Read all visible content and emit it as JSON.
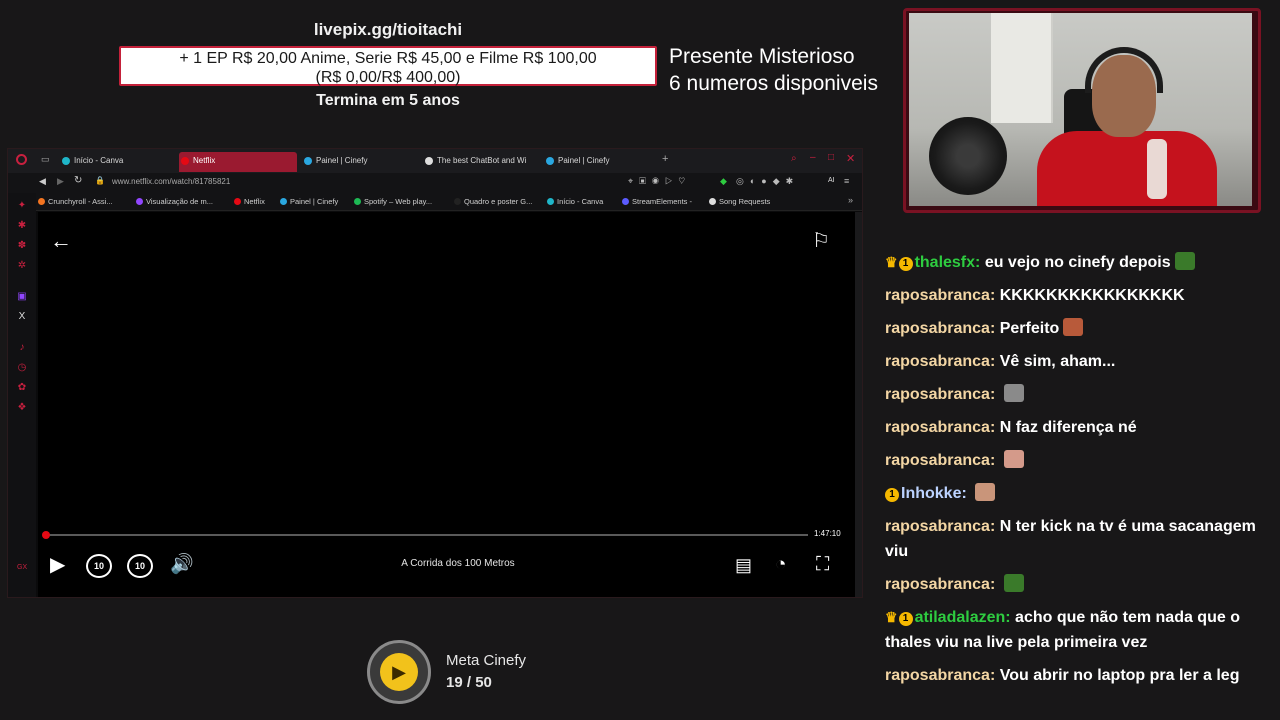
{
  "overlay": {
    "livepix": "livepix.gg/tioitachi",
    "goal_line1": "+ 1 EP R$ 20,00 Anime, Serie R$ 45,00 e Filme R$ 100,00",
    "goal_line2": "(R$ 0,00/R$ 400,00)",
    "goal_end": "Termina em 5 anos",
    "mystery_title": "Presente Misterioso",
    "mystery_sub": "6 numeros disponiveis"
  },
  "browser": {
    "tabs": [
      {
        "label": "Início - Canva",
        "active": false
      },
      {
        "label": "Netflix",
        "active": true
      },
      {
        "label": "Painel | Cinefy",
        "active": false
      },
      {
        "label": "The best ChatBot and Wi",
        "active": false
      },
      {
        "label": "Painel | Cinefy",
        "active": false
      }
    ],
    "url": "www.netflix.com/watch/81785821",
    "bookmarks": [
      "Crunchyroll - Assi...",
      "Visualização de m...",
      "Netflix",
      "Painel | Cinefy",
      "Spotify – Web play...",
      "Quadro e poster G...",
      "Início - Canva",
      "StreamElements -",
      "Song Requests"
    ],
    "ai_label": "AI"
  },
  "player": {
    "time_remaining": "1:47:10",
    "title": "A Corrida dos 100 Metros",
    "progress": 0.003,
    "skip_back": "10",
    "skip_forward": "10"
  },
  "meta": {
    "title": "Meta Cinefy",
    "current": "19",
    "separator": "/",
    "total": "50"
  },
  "chat": [
    {
      "user": "thalesfx",
      "text": "eu vejo no cinefy depois",
      "color": "green",
      "badges": [
        "crown",
        "1"
      ],
      "emote": "#3a7a2a"
    },
    {
      "user": "raposabranca",
      "text": "KKKKKKKKKKKKKKKK",
      "color": "tan",
      "badges": [],
      "emote": ""
    },
    {
      "user": "raposabranca",
      "text": "Perfeito",
      "color": "tan",
      "badges": [],
      "emote": "#b85a3a"
    },
    {
      "user": "raposabranca",
      "text": "Vê sim, aham...",
      "color": "tan",
      "badges": [],
      "emote": ""
    },
    {
      "user": "raposabranca",
      "text": "",
      "color": "tan",
      "badges": [],
      "emote": "#8a8a8a"
    },
    {
      "user": "raposabranca",
      "text": "N faz diferença né",
      "color": "tan",
      "badges": [],
      "emote": ""
    },
    {
      "user": "raposabranca",
      "text": "",
      "color": "tan",
      "badges": [],
      "emote": "#d49a8a"
    },
    {
      "user": "Inhokke",
      "text": "",
      "color": "blue",
      "badges": [
        "1"
      ],
      "emote": "#c9957a"
    },
    {
      "user": "raposabranca",
      "text": "N ter kick na tv é uma sacanagem viu",
      "color": "tan",
      "badges": [],
      "emote": ""
    },
    {
      "user": "raposabranca",
      "text": "",
      "color": "tan",
      "badges": [],
      "emote": "#3a7a2a"
    },
    {
      "user": "atiladalazen",
      "text": "acho que não tem nada que o thales viu na live pela primeira vez",
      "color": "green",
      "badges": [
        "crown",
        "1"
      ],
      "emote": ""
    },
    {
      "user": "raposabranca",
      "text": "Vou abrir no laptop pra ler a leg",
      "color": "tan",
      "badges": [],
      "emote": ""
    }
  ]
}
